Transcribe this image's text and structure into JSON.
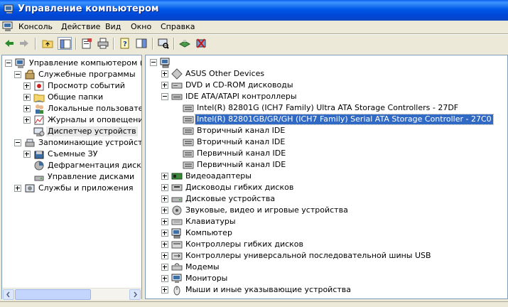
{
  "window": {
    "title": "Управление компьютером"
  },
  "menu": [
    "Консоль",
    "Действие",
    "Вид",
    "Окно",
    "Справка"
  ],
  "toolbar": {
    "buttons": [
      "back-icon",
      "forward-icon",
      "up-folder-icon",
      "show-tree-icon",
      "properties-icon",
      "print-icon",
      "help-icon",
      "show-hide-panel-icon",
      "scan-hardware-icon",
      "update-driver-icon",
      "uninstall-icon"
    ]
  },
  "left_tree": [
    {
      "label": "Управление компьютером (локаль",
      "level": 0,
      "expander": "minus",
      "icon": "computer-management-icon"
    },
    {
      "label": "Служебные программы",
      "level": 1,
      "expander": "minus",
      "icon": "system-tools-icon"
    },
    {
      "label": "Просмотр событий",
      "level": 2,
      "expander": "plus",
      "icon": "event-viewer-icon"
    },
    {
      "label": "Общие папки",
      "level": 2,
      "expander": "plus",
      "icon": "shared-folders-icon"
    },
    {
      "label": "Локальные пользователи",
      "level": 2,
      "expander": "plus",
      "icon": "local-users-icon"
    },
    {
      "label": "Журналы и оповещения пр",
      "level": 2,
      "expander": "plus",
      "icon": "performance-logs-icon"
    },
    {
      "label": "Диспетчер устройств",
      "level": 2,
      "expander": "none",
      "icon": "device-manager-icon",
      "selected": true
    },
    {
      "label": "Запоминающие устройства",
      "level": 1,
      "expander": "minus",
      "icon": "storage-icon"
    },
    {
      "label": "Съемные ЗУ",
      "level": 2,
      "expander": "plus",
      "icon": "removable-storage-icon"
    },
    {
      "label": "Дефрагментация диска",
      "level": 2,
      "expander": "none",
      "icon": "defrag-icon"
    },
    {
      "label": "Управление дисками",
      "level": 2,
      "expander": "none",
      "icon": "disk-management-icon"
    },
    {
      "label": "Службы и приложения",
      "level": 1,
      "expander": "plus",
      "icon": "services-apps-icon"
    }
  ],
  "device_tree": [
    {
      "label": "",
      "level": 0,
      "expander": "minus",
      "icon": "computer-icon"
    },
    {
      "label": "ASUS Other Devices",
      "level": 1,
      "expander": "plus",
      "icon": "other-devices-icon"
    },
    {
      "label": "DVD и CD-ROM дисководы",
      "level": 1,
      "expander": "plus",
      "icon": "cdrom-icon"
    },
    {
      "label": "IDE ATA/ATAPI контроллеры",
      "level": 1,
      "expander": "minus",
      "icon": "ide-controller-icon"
    },
    {
      "label": "Intel(R) 82801G (ICH7 Family) Ultra ATA Storage Controllers - 27DF",
      "level": 2,
      "expander": "none",
      "icon": "ide-channel-icon"
    },
    {
      "label": "Intel(R) 82801GB/GR/GH (ICH7 Family) Serial ATA Storage Controller - 27C0",
      "level": 2,
      "expander": "none",
      "icon": "ide-channel-icon",
      "selected": true
    },
    {
      "label": "Вторичный канал IDE",
      "level": 2,
      "expander": "none",
      "icon": "ide-channel-icon"
    },
    {
      "label": "Вторичный канал IDE",
      "level": 2,
      "expander": "none",
      "icon": "ide-channel-icon"
    },
    {
      "label": "Первичный канал IDE",
      "level": 2,
      "expander": "none",
      "icon": "ide-channel-icon"
    },
    {
      "label": "Первичный канал IDE",
      "level": 2,
      "expander": "none",
      "icon": "ide-channel-icon"
    },
    {
      "label": "Видеоадаптеры",
      "level": 1,
      "expander": "plus",
      "icon": "display-adapter-icon"
    },
    {
      "label": "Дисководы гибких дисков",
      "level": 1,
      "expander": "plus",
      "icon": "floppy-drive-icon"
    },
    {
      "label": "Дисковые устройства",
      "level": 1,
      "expander": "plus",
      "icon": "disk-drive-icon"
    },
    {
      "label": "Звуковые, видео и игровые устройства",
      "level": 1,
      "expander": "plus",
      "icon": "sound-icon"
    },
    {
      "label": "Клавиатуры",
      "level": 1,
      "expander": "plus",
      "icon": "keyboard-icon"
    },
    {
      "label": "Компьютер",
      "level": 1,
      "expander": "plus",
      "icon": "computer-icon"
    },
    {
      "label": "Контроллеры гибких дисков",
      "level": 1,
      "expander": "plus",
      "icon": "floppy-controller-icon"
    },
    {
      "label": "Контроллеры универсальной последовательной шины USB",
      "level": 1,
      "expander": "plus",
      "icon": "usb-icon"
    },
    {
      "label": "Модемы",
      "level": 1,
      "expander": "plus",
      "icon": "modem-icon"
    },
    {
      "label": "Мониторы",
      "level": 1,
      "expander": "plus",
      "icon": "monitor-icon"
    },
    {
      "label": "Мыши и иные указывающие устройства",
      "level": 1,
      "expander": "plus",
      "icon": "mouse-icon"
    }
  ]
}
